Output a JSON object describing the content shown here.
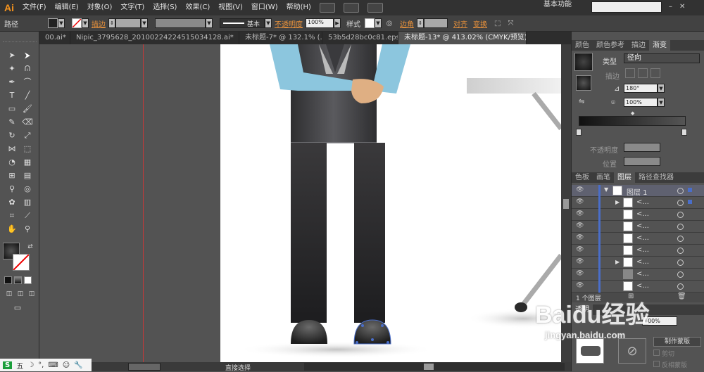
{
  "app": {
    "logo": "Ai",
    "workspace": "基本功能"
  },
  "menu": [
    "文件(F)",
    "编辑(E)",
    "对象(O)",
    "文字(T)",
    "选择(S)",
    "效果(C)",
    "视图(V)",
    "窗口(W)",
    "帮助(H)"
  ],
  "control": {
    "selection_type": "路径",
    "stroke_label": "描边",
    "brush_label": "基本",
    "opacity_label": "不透明度",
    "opacity_value": "100%",
    "style_label": "样式",
    "corner_label": "边角",
    "align_label": "对齐",
    "transform_label": "变换"
  },
  "tabs": [
    {
      "label": "00.ai*",
      "active": false
    },
    {
      "label": "Nipic_3795628_20100224224515034128.ai*",
      "active": false
    },
    {
      "label": "未标题-7* @ 132.1% (...",
      "active": false
    },
    {
      "label": "53b5d28bc0c81.eps*...",
      "active": false
    },
    {
      "label": "未标题-13* @ 413.02% (CMYK/预览)",
      "active": true
    }
  ],
  "gradient_panel": {
    "tabs": [
      "颜色",
      "颜色参考",
      "描边",
      "渐变"
    ],
    "type_label": "类型",
    "type_value": "径向",
    "stroke_label": "描边",
    "angle_value": "180°",
    "aspect_value": "100%",
    "opacity_label": "不透明度",
    "location_label": "位置"
  },
  "layers_panel": {
    "tabs": [
      "色板",
      "画笔",
      "图层",
      "路径查找器"
    ],
    "layer_name": "图层 1",
    "sublayers": [
      "<...",
      "<...",
      "<...",
      "<...",
      "<...",
      "<...",
      "<...",
      "<...",
      "<..."
    ],
    "count": "1 个图层"
  },
  "transparency": {
    "tab": "透明",
    "opacity": "100%",
    "mask_btn": "制作蒙版",
    "clip": "剪切",
    "invert": "反相蒙版"
  },
  "status": {
    "tool": "直接选择"
  },
  "watermark": {
    "brand": "Baidu经验",
    "url": "jingyan.baidu.com"
  },
  "ime": {
    "label": "五"
  }
}
